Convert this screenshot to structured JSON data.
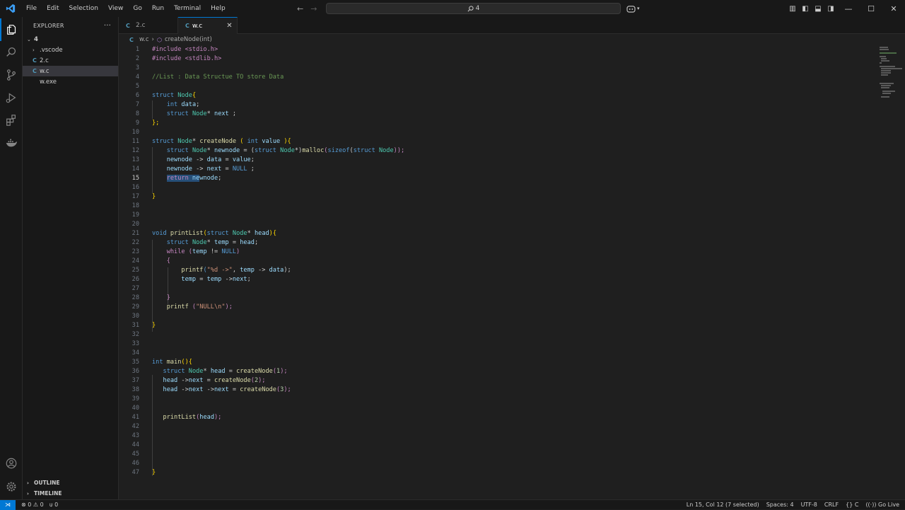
{
  "menu": [
    "File",
    "Edit",
    "Selection",
    "View",
    "Go",
    "Run",
    "Terminal",
    "Help"
  ],
  "search": {
    "text": "4"
  },
  "explorer": {
    "title": "EXPLORER",
    "root": "4",
    "items": [
      {
        "label": ".vscode",
        "type": "folder"
      },
      {
        "label": "2.c",
        "type": "c"
      },
      {
        "label": "w.c",
        "type": "c",
        "selected": true
      },
      {
        "label": "w.exe",
        "type": "exe"
      }
    ],
    "outline": "OUTLINE",
    "timeline": "TIMELINE"
  },
  "tabs": [
    {
      "label": "2.c",
      "active": false
    },
    {
      "label": "w.c",
      "active": true,
      "close": "✕"
    }
  ],
  "breadcrumb": {
    "file": "w.c",
    "symbol": "createNode(int)"
  },
  "code_lines": [
    {
      "n": "1"
    },
    {
      "n": "2"
    },
    {
      "n": "3"
    },
    {
      "n": "4"
    },
    {
      "n": "5"
    },
    {
      "n": "6"
    },
    {
      "n": "7"
    },
    {
      "n": "8"
    },
    {
      "n": "9"
    },
    {
      "n": "10"
    },
    {
      "n": "11"
    },
    {
      "n": "12"
    },
    {
      "n": "13"
    },
    {
      "n": "14"
    },
    {
      "n": "15"
    },
    {
      "n": "16"
    },
    {
      "n": "17"
    },
    {
      "n": "18"
    },
    {
      "n": "19"
    },
    {
      "n": "20"
    },
    {
      "n": "21"
    },
    {
      "n": "22"
    },
    {
      "n": "23"
    },
    {
      "n": "24"
    },
    {
      "n": "25"
    },
    {
      "n": "26"
    },
    {
      "n": "27"
    },
    {
      "n": "28"
    },
    {
      "n": "29"
    },
    {
      "n": "30"
    },
    {
      "n": "31"
    },
    {
      "n": "32"
    },
    {
      "n": "33"
    },
    {
      "n": "34"
    },
    {
      "n": "35"
    },
    {
      "n": "36"
    },
    {
      "n": "37"
    },
    {
      "n": "38"
    },
    {
      "n": "39"
    },
    {
      "n": "40"
    },
    {
      "n": "41"
    },
    {
      "n": "42"
    },
    {
      "n": "43"
    },
    {
      "n": "44"
    },
    {
      "n": "45"
    },
    {
      "n": "46"
    },
    {
      "n": "47"
    }
  ],
  "code_text": {
    "l1": "#include <stdio.h>",
    "l2": "#include <stdlib.h>",
    "l4": "//List : Data Structue TO store Data",
    "l6a": "struct",
    "l6b": "Node",
    "l6c": "{",
    "l7a": "int",
    "l7b": "data",
    "l7c": ";",
    "l8a": "struct",
    "l8b": "Node",
    "l8c": "*",
    "l8d": "next",
    "l8e": " ;",
    "l9": "};",
    "l11a": "struct",
    "l11b": "Node",
    "l11c": "*",
    "l11d": "createNode",
    "l11e": " ( ",
    "l11f": "int",
    "l11g": "value",
    "l11h": " ){",
    "l12a": "struct",
    "l12b": "Node",
    "l12c": "*",
    "l12d": "newnode",
    "l12e": " = (",
    "l12f": "struct",
    "l12g": "Node",
    "l12h": "*)",
    "l12i": "malloc",
    "l12j": "(",
    "l12k": "sizeof",
    "l12l": "(",
    "l12m": "struct",
    "l12n": "Node",
    "l12o": "));",
    "l13a": "newnode",
    "l13b": " -> ",
    "l13c": "data",
    "l13d": " = ",
    "l13e": "value",
    "l13f": ";",
    "l14a": "newnode",
    "l14b": " -> ",
    "l14c": "next",
    "l14d": " = ",
    "l14e": "NULL",
    "l14f": " ;",
    "l15a": "return",
    "l15b": " ne",
    "l15c": "wnode",
    "l15d": ";",
    "l17": "}",
    "l21a": "void",
    "l21b": "printList",
    "l21c": "(",
    "l21d": "struct",
    "l21e": "Node",
    "l21f": "*",
    "l21g": "head",
    "l21h": "){",
    "l22a": "struct",
    "l22b": "Node",
    "l22c": "*",
    "l22d": "temp",
    "l22e": " = ",
    "l22f": "head",
    "l22g": ";",
    "l23a": "while",
    "l23b": " (",
    "l23c": "temp",
    "l23d": " != ",
    "l23e": "NULL",
    "l23f": ")",
    "l24": "{",
    "l25a": "printf",
    "l25b": "(",
    "l25c": "\"%d ->\"",
    "l25d": ", ",
    "l25e": "temp",
    "l25f": " -> ",
    "l25g": "data",
    "l25h": ");",
    "l26a": "temp",
    "l26b": " = ",
    "l26c": "temp",
    "l26d": " ->",
    "l26e": "next",
    "l26f": ";",
    "l28": "}",
    "l29a": "printf",
    "l29b": " (",
    "l29c": "\"NULL\\n\"",
    "l29d": ");",
    "l31": "}",
    "l35a": "int",
    "l35b": "main",
    "l35c": "(){",
    "l36a": "struct",
    "l36b": "Node",
    "l36c": "*",
    "l36d": "head",
    "l36e": " = ",
    "l36f": "createNode",
    "l36g": "(",
    "l36h": "1",
    "l36i": ");",
    "l37a": "head",
    "l37b": " ->",
    "l37c": "next",
    "l37d": " = ",
    "l37e": "createNode",
    "l37f": "(",
    "l37g": "2",
    "l37h": ");",
    "l38a": "head",
    "l38b": " ->",
    "l38c": "next",
    "l38d": " ->",
    "l38e": "next",
    "l38f": " = ",
    "l38g": "createNode",
    "l38h": "(",
    "l38i": "3",
    "l38j": ");",
    "l41a": "printList",
    "l41b": "(",
    "l41c": "head",
    "l41d": ");",
    "l47": "}"
  },
  "status": {
    "errors": "0",
    "warnings": "0",
    "ports": "0",
    "position": "Ln 15, Col 12 (7 selected)",
    "spaces": "Spaces: 4",
    "encoding": "UTF-8",
    "eol": "CRLF",
    "language": "C",
    "golive": "Go Live"
  },
  "colors": {
    "accent": "#0078d4",
    "keyword": "#569cd6",
    "type": "#4ec9b0",
    "function": "#dcdcaa",
    "variable": "#9cdcfe",
    "string": "#ce9178",
    "number": "#b5cea8",
    "comment": "#6a9955"
  }
}
